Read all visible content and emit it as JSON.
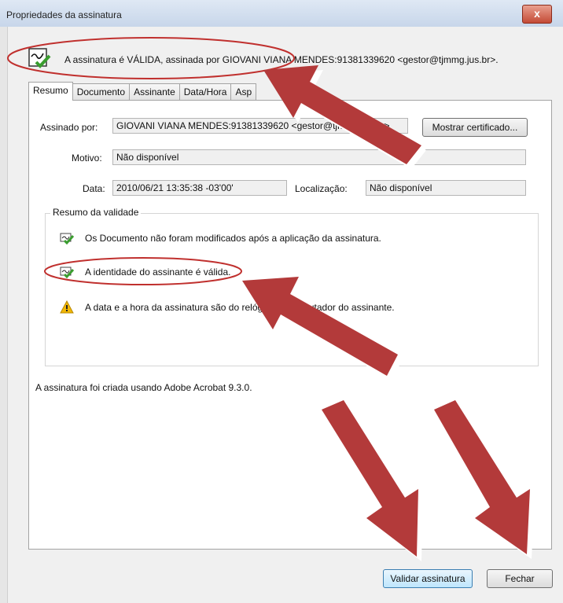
{
  "window": {
    "title": "Propriedades da assinatura",
    "close_glyph": "x"
  },
  "status": {
    "text": "A assinatura é VÁLIDA, assinada por GIOVANI VIANA MENDES:91381339620 <gestor@tjmmg.jus.br>."
  },
  "tabs": [
    {
      "label": "Resumo",
      "active": true
    },
    {
      "label": "Documento",
      "active": false
    },
    {
      "label": "Assinante",
      "active": false
    },
    {
      "label": "Data/Hora",
      "active": false
    },
    {
      "label": "Asp",
      "active": false
    }
  ],
  "resumo": {
    "signed_by_label": "Assinado por:",
    "signed_by_value": "GIOVANI VIANA MENDES:91381339620 <gestor@tjmmg.jus.br>",
    "show_cert_button": "Mostrar certificado...",
    "reason_label": "Motivo:",
    "reason_value": "Não disponível",
    "date_label": "Data:",
    "date_value": "2010/06/21 13:35:38 -03'00'",
    "location_label": "Localização:",
    "location_value": "Não disponível"
  },
  "validation": {
    "group_title": "Resumo da validade",
    "items": [
      {
        "icon": "valid-signature-icon",
        "text": "Os Documento não foram modificados após a aplicação da assinatura."
      },
      {
        "icon": "valid-signature-icon",
        "text": "A identidade do assinante é válida."
      },
      {
        "icon": "warning-icon",
        "text": "A data e a hora da assinatura são do relógio do computador do assinante."
      }
    ]
  },
  "footer_note": "A assinatura foi criada usando Adobe Acrobat 9.3.0.",
  "buttons": {
    "validate": "Validar assinatura",
    "close": "Fechar"
  },
  "colors": {
    "annotation_red": "#b33a3a",
    "ellipse_red": "#c0302e",
    "valid_green": "#3a9d2f",
    "warning_yellow": "#f2b705"
  }
}
